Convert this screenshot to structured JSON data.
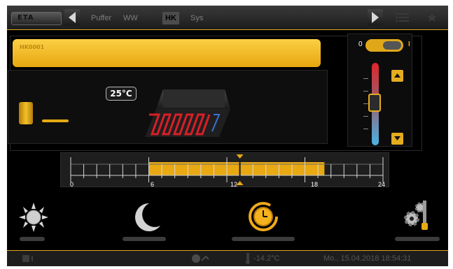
{
  "header": {
    "logo_text": "ETA",
    "tabs": [
      {
        "label": "Puffer",
        "active": false
      },
      {
        "label": "WW",
        "active": false
      },
      {
        "label": "HK",
        "active": true
      },
      {
        "label": "Sys",
        "active": false
      }
    ]
  },
  "circuit": {
    "name_label": "HK0001",
    "flow_temperature": "25°C"
  },
  "mode_toggle": {
    "off_label": "0",
    "on_label": "I",
    "state": "on"
  },
  "timeline": {
    "hour_labels": [
      "0",
      "6",
      "12",
      "18",
      "24"
    ],
    "active_from_hour": 6,
    "active_to_hour": 19.5,
    "current_hour": 13
  },
  "footer": {
    "outside_temperature": "-14.2°C",
    "datetime": "Mo., 15.04.2018 18:54:31"
  },
  "colors": {
    "accent": "#e8a912",
    "background": "#000000",
    "text_dim": "#555555"
  }
}
